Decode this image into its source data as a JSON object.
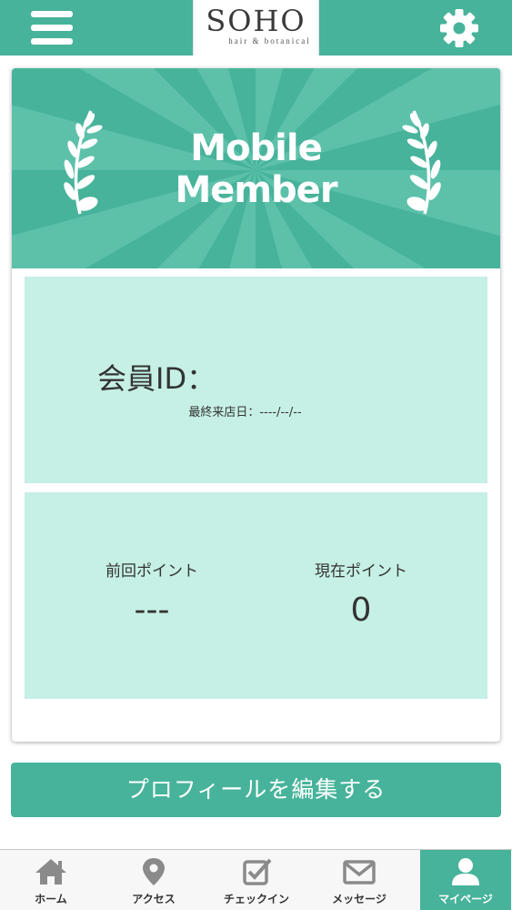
{
  "header": {
    "logo": "SOHO",
    "logo_sub": "hair & botanical",
    "menu_icon": "hamburger-menu-icon",
    "settings_icon": "gear-icon"
  },
  "banner": {
    "title_line1": "Mobile",
    "title_line2": "Member"
  },
  "member": {
    "id_label": "会員ID：",
    "last_visit": "最終来店日：----/--/--"
  },
  "points": {
    "previous_label": "前回ポイント",
    "previous_value": "---",
    "current_label": "現在ポイント",
    "current_value": "0"
  },
  "profile_button": "プロフィールを編集する",
  "tabs": [
    {
      "label": "ホーム",
      "icon": "home-icon"
    },
    {
      "label": "アクセス",
      "icon": "map-pin-icon"
    },
    {
      "label": "チェックイン",
      "icon": "checkin-icon"
    },
    {
      "label": "メッセージ",
      "icon": "envelope-icon"
    },
    {
      "label": "マイページ",
      "icon": "user-icon",
      "active": true
    }
  ],
  "colors": {
    "accent": "#47b39a",
    "panel": "#c6f0e5"
  }
}
